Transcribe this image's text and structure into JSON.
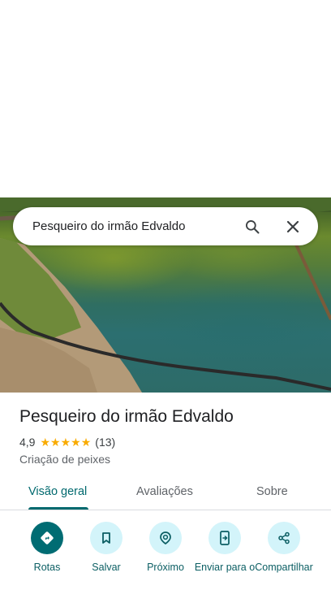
{
  "search": {
    "query": "Pesqueiro do irmão Edvaldo",
    "search_icon": "search-icon",
    "close_icon": "close-icon"
  },
  "photo": {
    "description_icon": "place-photo"
  },
  "place": {
    "title": "Pesqueiro do irmão Edvaldo",
    "rating": "4,9",
    "stars": 5,
    "review_count": "(13)",
    "category": "Criação de peixes"
  },
  "tabs": [
    {
      "label": "Visão geral",
      "active": true
    },
    {
      "label": "Avaliações",
      "active": false
    },
    {
      "label": "Sobre",
      "active": false
    }
  ],
  "actions": [
    {
      "label": "Rotas",
      "icon": "directions-icon"
    },
    {
      "label": "Salvar",
      "icon": "bookmark-icon"
    },
    {
      "label": "Próximo",
      "icon": "nearby-icon"
    },
    {
      "label": "Enviar para o",
      "icon": "send-to-phone-icon"
    },
    {
      "label": "Compartilhar",
      "icon": "share-icon"
    }
  ],
  "colors": {
    "accent": "#00696e",
    "action_bg": "#d3f4fa",
    "star": "#f9ab00"
  }
}
